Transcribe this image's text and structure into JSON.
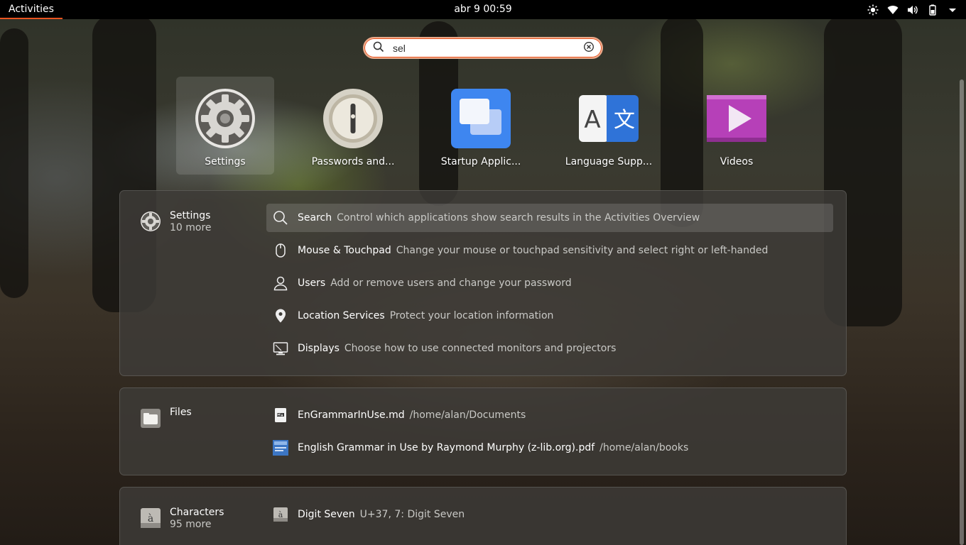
{
  "topbar": {
    "activities": "Activities",
    "clock": "abr 9  00:59",
    "tray_icons": [
      "brightness-icon",
      "wifi-icon",
      "volume-icon",
      "battery-icon",
      "menu-arrow-icon"
    ]
  },
  "search": {
    "value": "sel",
    "icon": "search-icon",
    "clear_icon": "clear-icon"
  },
  "apps": [
    {
      "label": "Settings",
      "icon": "settings-gear-icon",
      "selected": true
    },
    {
      "label": "Passwords and...",
      "icon": "passwords-keyring-icon"
    },
    {
      "label": "Startup Applic...",
      "icon": "startup-applications-icon"
    },
    {
      "label": "Language Supp...",
      "icon": "language-support-icon"
    },
    {
      "label": "Videos",
      "icon": "videos-icon"
    }
  ],
  "settings_results": {
    "provider": "Settings",
    "more": "10 more",
    "items": [
      {
        "title": "Search",
        "description": "Control which applications show search results in the Activities Overview",
        "icon": "search-icon"
      },
      {
        "title": "Mouse & Touchpad",
        "description": "Change your mouse or touchpad sensitivity and select right or left-handed",
        "icon": "mouse-icon"
      },
      {
        "title": "Users",
        "description": "Add or remove users and change your password",
        "icon": "user-icon"
      },
      {
        "title": "Location Services",
        "description": "Protect your location information",
        "icon": "location-pin-icon"
      },
      {
        "title": "Displays",
        "description": "Choose how to use connected monitors and projectors",
        "icon": "display-icon"
      }
    ]
  },
  "files_results": {
    "provider": "Files",
    "items": [
      {
        "title": "EnGrammarInUse.md",
        "description": "/home/alan/Documents",
        "icon": "markdown-file-icon"
      },
      {
        "title": "English Grammar in Use by Raymond Murphy (z-lib.org).pdf",
        "description": "/home/alan/books",
        "icon": "pdf-thumbnail-icon"
      }
    ]
  },
  "characters_results": {
    "provider": "Characters",
    "more": "95 more",
    "items": [
      {
        "title": "Digit Seven",
        "description": "U+37, 7: Digit Seven",
        "icon": "character-icon"
      }
    ]
  },
  "colors": {
    "accent": "#e95420",
    "topbar": "#000000",
    "panel": "#3e3c38"
  }
}
